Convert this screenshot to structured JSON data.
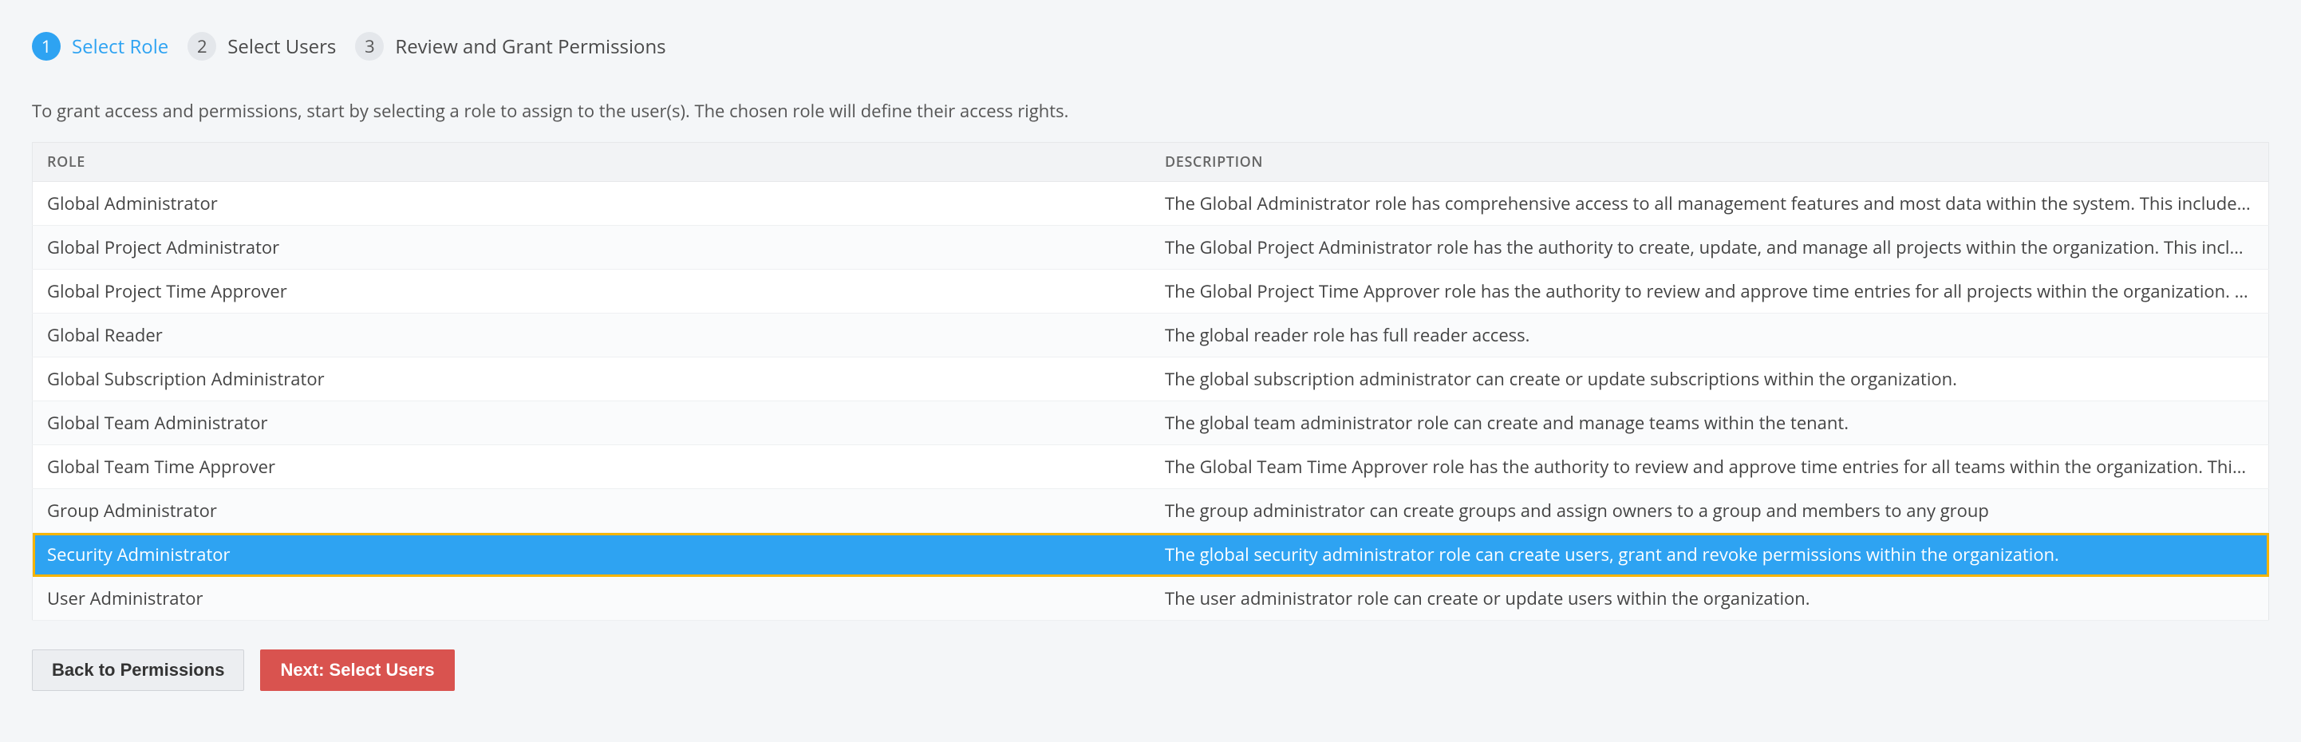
{
  "stepper": {
    "steps": [
      {
        "num": "1",
        "label": "Select Role",
        "active": true
      },
      {
        "num": "2",
        "label": "Select Users",
        "active": false
      },
      {
        "num": "3",
        "label": "Review and Grant Permissions",
        "active": false
      }
    ]
  },
  "instruction": "To grant access and permissions, start by selecting a role to assign to the user(s). The chosen role will define their access rights.",
  "table": {
    "headers": {
      "role": "Role",
      "description": "Description"
    },
    "rows": [
      {
        "role": "Global Administrator",
        "description": "The Global Administrator role has comprehensive access to all management features and most data within the system. This includes the ability to manage u…",
        "selected": false
      },
      {
        "role": "Global Project Administrator",
        "description": "The Global Project Administrator role has the authority to create, update, and manage all projects within the organization. This includes the ability to assign …",
        "selected": false
      },
      {
        "role": "Global Project Time Approver",
        "description": "The Global Project Time Approver role has the authority to review and approve time entries for all projects within the organization. This includes the ability t…",
        "selected": false
      },
      {
        "role": "Global Reader",
        "description": "The global reader role has full reader access.",
        "selected": false
      },
      {
        "role": "Global Subscription Administrator",
        "description": "The global subscription administrator can create or update subscriptions within the organization.",
        "selected": false
      },
      {
        "role": "Global Team Administrator",
        "description": "The global team administrator role can create and manage teams within the tenant.",
        "selected": false
      },
      {
        "role": "Global Team Time Approver",
        "description": "The Global Team Time Approver role has the authority to review and approve time entries for all teams within the organization. This includes the ability to m…",
        "selected": false
      },
      {
        "role": "Group Administrator",
        "description": "The group administrator can create groups and assign owners to a group and members to any group",
        "selected": false
      },
      {
        "role": "Security Administrator",
        "description": "The global security administrator role can create users, grant and revoke permissions within the organization.",
        "selected": true
      },
      {
        "role": "User Administrator",
        "description": "The user administrator role can create or update users within the organization.",
        "selected": false
      }
    ]
  },
  "buttons": {
    "back": "Back to Permissions",
    "next": "Next: Select Users"
  }
}
